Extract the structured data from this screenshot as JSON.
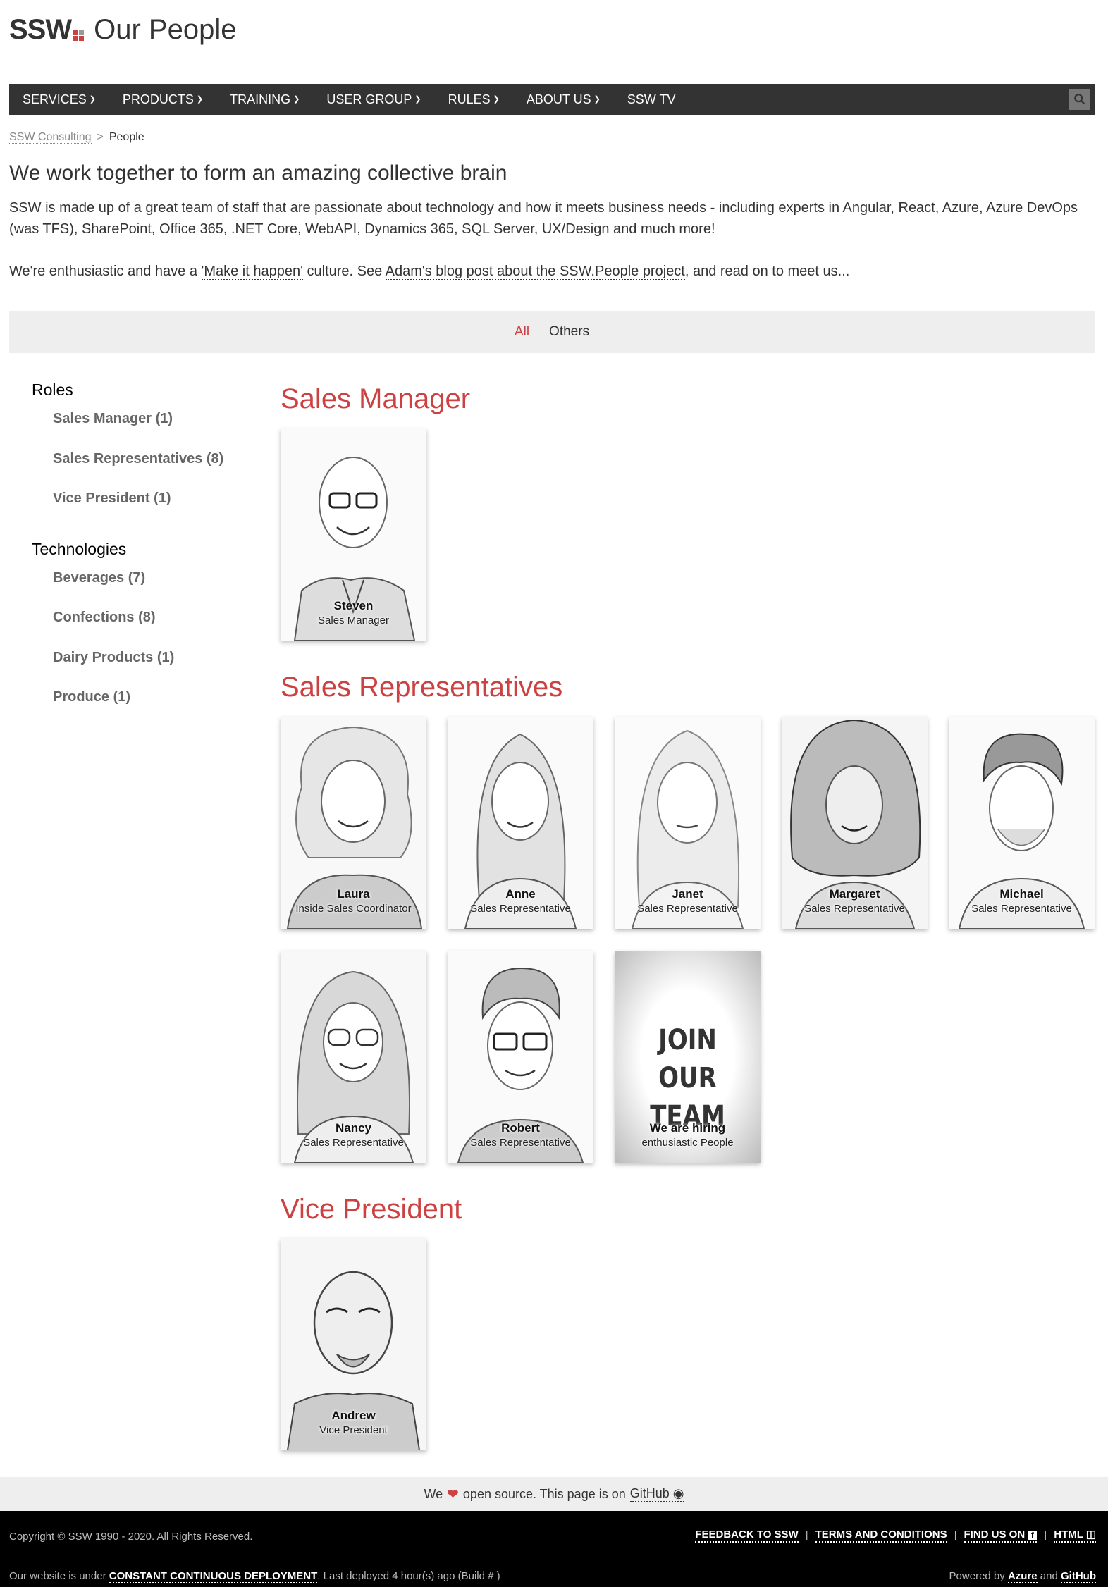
{
  "header": {
    "logo_text": "SSW",
    "site_title": "Our People"
  },
  "nav": {
    "items": [
      {
        "label": "SERVICES",
        "chevron": true
      },
      {
        "label": "PRODUCTS",
        "chevron": true
      },
      {
        "label": "TRAINING",
        "chevron": true
      },
      {
        "label": "USER GROUP",
        "chevron": true
      },
      {
        "label": "RULES",
        "chevron": true
      },
      {
        "label": "ABOUT US",
        "chevron": true
      },
      {
        "label": "SSW TV",
        "chevron": false
      }
    ],
    "search_icon": "search-icon"
  },
  "breadcrumb": {
    "parent": "SSW Consulting",
    "separator": ">",
    "current": "People"
  },
  "intro": {
    "title": "We work together to form an amazing collective brain",
    "p1": "SSW is made up of a great team of staff that are passionate about technology and how it meets business needs - including experts in Angular, React, Azure, Azure DevOps (was TFS), SharePoint, Office 365, .NET Core, WebAPI, Dynamics 365, SQL Server, UX/Design and much more!",
    "p2_before": "We're enthusiastic and have a ",
    "p2_link1": "'Make it happen'",
    "p2_middle": " culture. See ",
    "p2_link2": "Adam's blog post about the SSW.People project",
    "p2_after": ", and read on to meet us..."
  },
  "filter": {
    "tabs": [
      "All",
      "Others"
    ],
    "active": "All"
  },
  "sidebar": {
    "roles_heading": "Roles",
    "roles": [
      "Sales Manager (1)",
      "Sales Representatives (8)",
      "Vice President (1)"
    ],
    "tech_heading": "Technologies",
    "technologies": [
      "Beverages (7)",
      "Confections (8)",
      "Dairy Products (1)",
      "Produce (1)"
    ]
  },
  "sections": {
    "sales_manager": {
      "title": "Sales Manager",
      "people": [
        {
          "name": "Steven",
          "role": "Sales Manager"
        }
      ]
    },
    "sales_reps": {
      "title": "Sales Representatives",
      "people": [
        {
          "name": "Laura",
          "role": "Inside Sales Coordinator"
        },
        {
          "name": "Anne",
          "role": "Sales Representative"
        },
        {
          "name": "Janet",
          "role": "Sales Representative"
        },
        {
          "name": "Margaret",
          "role": "Sales Representative"
        },
        {
          "name": "Michael",
          "role": "Sales Representative"
        },
        {
          "name": "Nancy",
          "role": "Sales Representative"
        },
        {
          "name": "Robert",
          "role": "Sales Representative"
        }
      ],
      "join": {
        "headline_line1": "JOIN OUR",
        "headline_line2": "TEAM",
        "title": "We are hiring",
        "subtitle": "enthusiastic People"
      }
    },
    "vice_president": {
      "title": "Vice President",
      "people": [
        {
          "name": "Andrew",
          "role": "Vice President"
        }
      ]
    }
  },
  "footer": {
    "oss_before": "We",
    "oss_after": "open source. This page is on",
    "oss_link": "GitHub",
    "copyright": "Copyright © SSW 1990 - 2020. All Rights Reserved.",
    "links": [
      "FEEDBACK TO SSW",
      "TERMS AND CONDITIONS",
      "FIND US ON",
      "HTML"
    ],
    "deploy_before": "Our website is under",
    "deploy_strong": "CONSTANT CONTINUOUS DEPLOYMENT",
    "deploy_after": ". Last deployed 4 hour(s) ago (Build # )",
    "powered_before": "Powered by",
    "powered_azure": "Azure",
    "powered_and": "and",
    "powered_github": "GitHub"
  },
  "colors": {
    "accent": "#cc4141",
    "nav_bg": "#333333",
    "footer_bg": "#000000"
  }
}
